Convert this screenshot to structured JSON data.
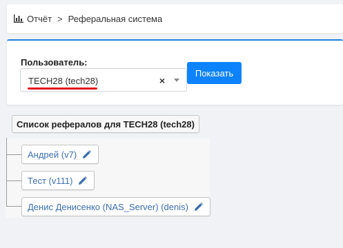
{
  "breadcrumb": {
    "icon": "bar-chart-icon",
    "items": [
      "Отчёт",
      "Реферальная система"
    ],
    "separator": ">"
  },
  "form": {
    "user_label": "Пользователь:",
    "selected_user": "TECH28 (tech28)",
    "clear_symbol": "×",
    "show_button": "Показать",
    "accent_color": "#0d83fd",
    "underline_color": "#e3141b"
  },
  "referrals": {
    "title": "Список рефералов для TECH28 (tech28)",
    "items": [
      {
        "label": "Андрей (v7)",
        "icon": "pencil-icon"
      },
      {
        "label": "Тест (v111)",
        "icon": "pencil-icon"
      },
      {
        "label": "Денис Денисенко (NAS_Server) (denis)",
        "icon": "pencil-icon"
      }
    ],
    "link_color": "#3c6fae"
  }
}
